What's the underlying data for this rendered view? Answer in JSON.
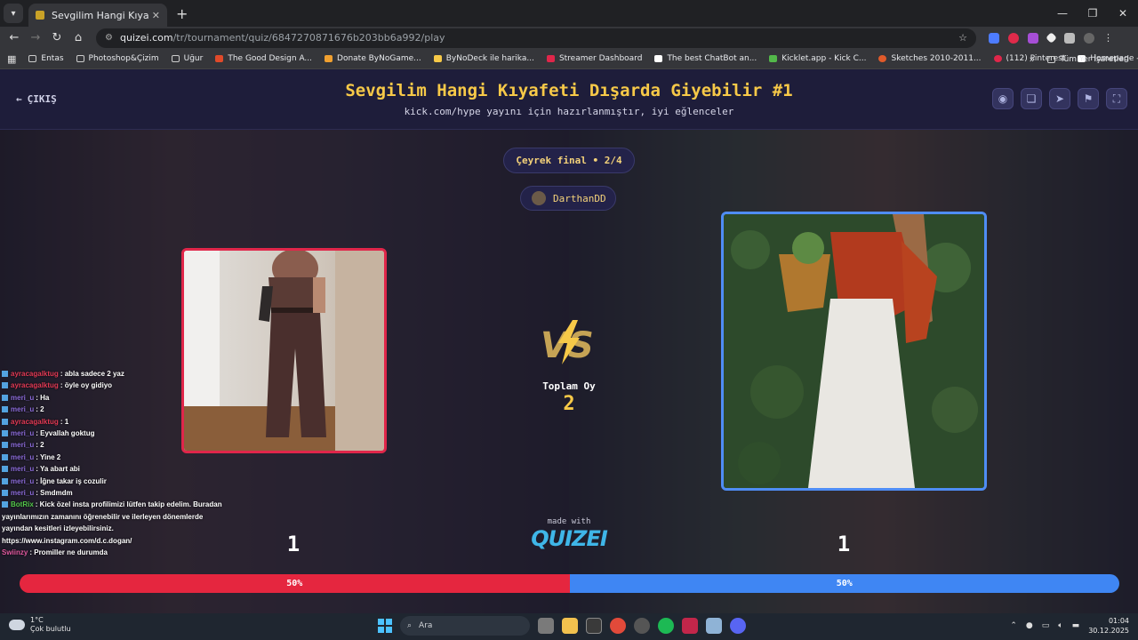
{
  "browser": {
    "tab_title": "Sevgilim Hangi Kıyafeti Dışarda",
    "url_host": "quizei.com",
    "url_path": "/tr/tournament/quiz/6847270871676b203bb6a992/play",
    "bookmarks": [
      "Entas",
      "Photoshop&Çizim",
      "Uğur",
      "The Good Design A...",
      "Donate ByNoGame...",
      "ByNoDeck ile harika...",
      "Streamer Dashboard",
      "The best ChatBot an...",
      "Kicklet.app - Kick C...",
      "Sketches 2010-2011...",
      "(112) Pinterest",
      "Homepage - Materi..."
    ],
    "bookmarks_more": "»",
    "bookmarks_all": "Tüm Yer İşaretleri"
  },
  "header": {
    "back_label": "ÇIKIŞ",
    "title": "Sevgilim Hangi Kıyafeti Dışarda Giyebilir #1",
    "subtitle": "kick.com/hype yayını için hazırlanmıştır, iyi eğlenceler"
  },
  "round": {
    "label": "Çeyrek final • 2/4",
    "username": "DarthanDD",
    "total_label": "Toplam Oy",
    "total_value": "2"
  },
  "scores": {
    "left": "1",
    "right": "1",
    "left_pct": "50%",
    "right_pct": "50%",
    "left_fraction": 0.5
  },
  "branding": {
    "made_with": "made with",
    "logo": "QUIZEI"
  },
  "colors": {
    "left_accent": "#e5263f",
    "right_accent": "#3f86f3",
    "title": "#f7c948"
  },
  "chat": [
    {
      "user": "ayracagalktug",
      "color": "#e23a55",
      "text": ": abla sadece 2 yaz"
    },
    {
      "user": "ayracagalktug",
      "color": "#e23a55",
      "text": ": öyle oy gidiyo"
    },
    {
      "user": "meri_u",
      "color": "#8b6bd9",
      "text": ": Ha"
    },
    {
      "user": "meri_u",
      "color": "#8b6bd9",
      "text": ": 2"
    },
    {
      "user": "ayracagalktug",
      "color": "#e23a55",
      "text": ": 1"
    },
    {
      "user": "meri_u",
      "color": "#8b6bd9",
      "text": ": Eyvallah goktug"
    },
    {
      "user": "meri_u",
      "color": "#8b6bd9",
      "text": ": 2"
    },
    {
      "user": "meri_u",
      "color": "#8b6bd9",
      "text": ": Yine 2"
    },
    {
      "user": "meri_u",
      "color": "#8b6bd9",
      "text": ": Ya abart abi"
    },
    {
      "user": "meri_u",
      "color": "#8b6bd9",
      "text": ": İğne takar iş cozulir"
    },
    {
      "user": "meri_u",
      "color": "#8b6bd9",
      "text": ": Smdmdm"
    }
  ],
  "chat_bot": {
    "user": "BotRix",
    "text": ": Kick özel insta profilimizi lütfen takip edelim. Buradan yayınlarımızın zamanını öğrenebilir ve ilerleyen dönemlerde yayından kesitleri izleyebilirsiniz. https://www.instagram.com/d.c.dogan/"
  },
  "chat_last": {
    "user": "Swiinzy",
    "text": ": Promiller ne durumda"
  },
  "taskbar": {
    "temp": "1°C",
    "weather": "Çok bulutlu",
    "search": "Ara",
    "time": "01:04",
    "date": "30.12.2025"
  }
}
